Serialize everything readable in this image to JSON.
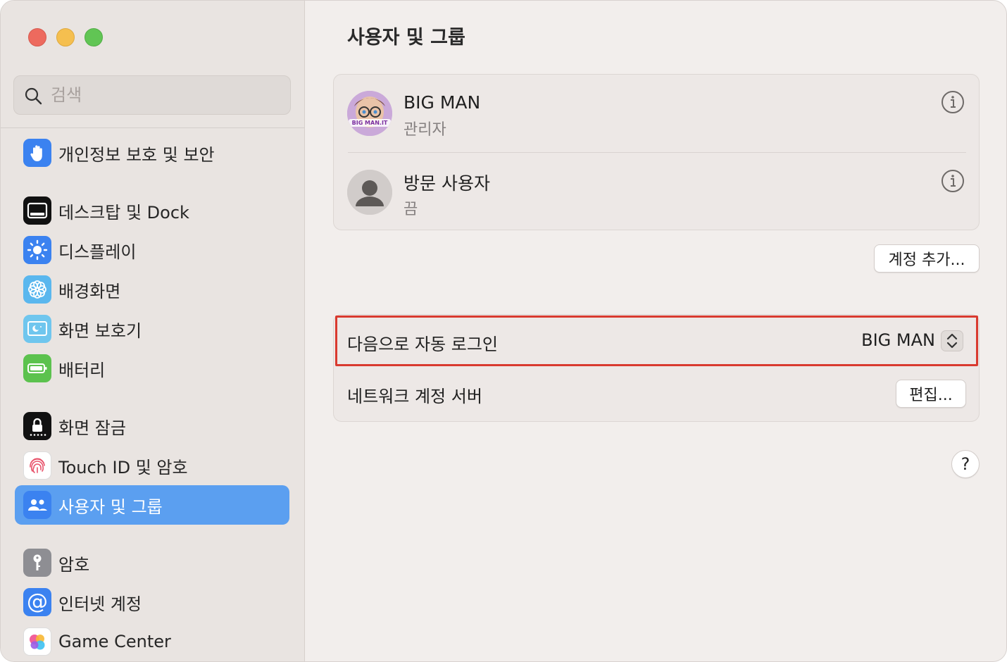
{
  "window": {
    "title": "사용자 및 그룹"
  },
  "search": {
    "placeholder": "검색"
  },
  "sidebar": {
    "items": [
      {
        "label": "개인정보 보호 및 보안",
        "icon": "hand-icon",
        "active": false
      },
      {
        "label": "데스크탑 및 Dock",
        "icon": "dock-icon",
        "active": false
      },
      {
        "label": "디스플레이",
        "icon": "sun-icon",
        "active": false
      },
      {
        "label": "배경화면",
        "icon": "flower-icon",
        "active": false
      },
      {
        "label": "화면 보호기",
        "icon": "screensaver-icon",
        "active": false
      },
      {
        "label": "배터리",
        "icon": "battery-icon",
        "active": false
      },
      {
        "label": "화면 잠금",
        "icon": "lock-icon",
        "active": false
      },
      {
        "label": "Touch ID 및 암호",
        "icon": "fingerprint-icon",
        "active": false
      },
      {
        "label": "사용자 및 그룹",
        "icon": "users-icon",
        "active": true
      },
      {
        "label": "암호",
        "icon": "key-icon",
        "active": false
      },
      {
        "label": "인터넷 계정",
        "icon": "at-icon",
        "active": false
      },
      {
        "label": "Game Center",
        "icon": "game-center-icon",
        "active": false
      }
    ]
  },
  "main": {
    "title": "사용자 및 그룹",
    "users": [
      {
        "name": "BIG MAN",
        "role": "관리자",
        "avatar_text": "BIG MAN.IT"
      },
      {
        "name": "방문 사용자",
        "role": "끔"
      }
    ],
    "add_account_label": "계정 추가...",
    "auto_login": {
      "label": "다음으로 자동 로그인",
      "value": "BIG MAN"
    },
    "network_server": {
      "label": "네트워크 계정 서버",
      "edit_label": "편집..."
    },
    "help_label": "?"
  },
  "colors": {
    "accent": "#5b9ff0",
    "highlight_border": "#d93a2f"
  }
}
